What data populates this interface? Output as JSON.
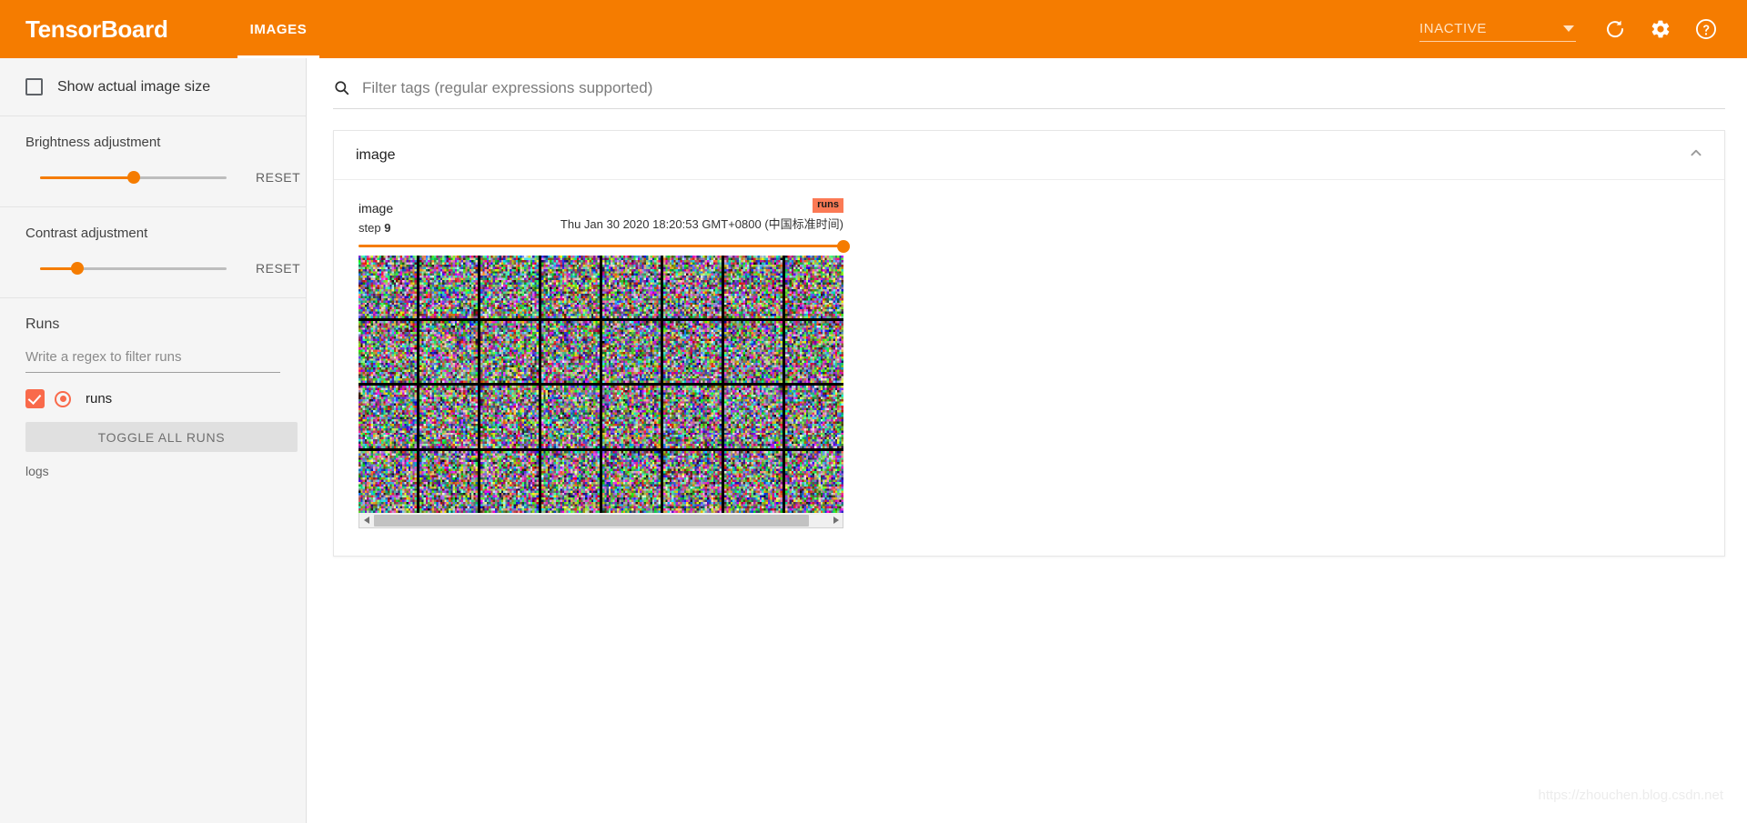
{
  "header": {
    "brand": "TensorBoard",
    "tabs": [
      {
        "label": "IMAGES",
        "active": true
      }
    ],
    "run_selector": {
      "value": "INACTIVE",
      "caret_icon": "chevron-down-icon"
    },
    "icons": {
      "refresh": "refresh-icon",
      "settings": "gear-icon",
      "help": "help-circle-icon"
    },
    "accent_color": "#f57c00"
  },
  "sidebar": {
    "show_actual_size": {
      "label": "Show actual image size",
      "checked": false
    },
    "brightness": {
      "title": "Brightness adjustment",
      "reset_label": "RESET",
      "value_pct": 50
    },
    "contrast": {
      "title": "Contrast adjustment",
      "reset_label": "RESET",
      "value_pct": 20
    },
    "runs": {
      "title": "Runs",
      "filter_placeholder": "Write a regex to filter runs",
      "filter_value": "",
      "items": [
        {
          "name": "runs",
          "checked": true,
          "color": "#f96a4b"
        }
      ],
      "toggle_all_label": "TOGGLE ALL RUNS",
      "logs_label": "logs"
    }
  },
  "main": {
    "search": {
      "placeholder": "Filter tags (regular expressions supported)",
      "value": "",
      "icon": "search-icon"
    },
    "card": {
      "title": "image",
      "collapse_icon": "chevron-up-icon",
      "image_card": {
        "tag": "image",
        "step_label": "step",
        "step_value": "9",
        "timestamp": "Thu Jan 30 2020 18:20:53 GMT+0800 (中国标准时间)",
        "run_badge": "runs",
        "run_badge_color": "#fb7a55",
        "step_slider_pct": 100,
        "grid_cols": 8,
        "grid_rows": 4,
        "scrollbar": {
          "left_arrow": "arrow-left-icon",
          "right_arrow": "arrow-right-icon",
          "thumb_pct": 92
        }
      }
    }
  },
  "watermark": {
    "text": "https://zhouchen.blog.csdn.net"
  }
}
